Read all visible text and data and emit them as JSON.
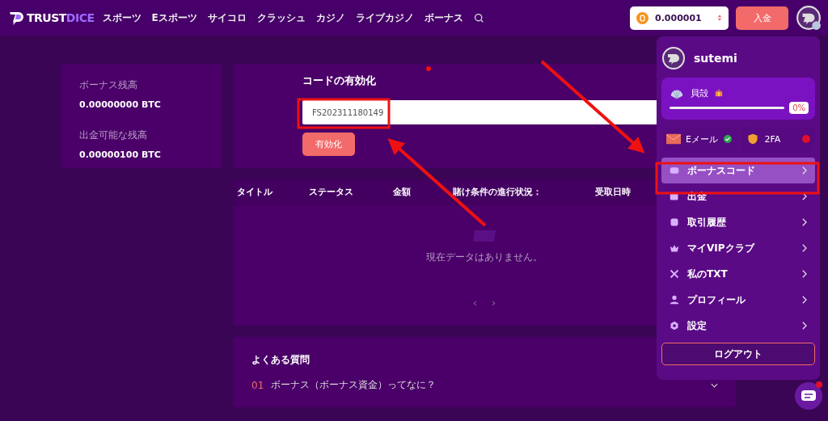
{
  "header": {
    "logo": {
      "part_1": "TRUST",
      "part_2": "DICE"
    },
    "nav": [
      {
        "label": "スポーツ"
      },
      {
        "label": "Eスポーツ"
      },
      {
        "label": "サイコロ"
      },
      {
        "label": "クラッシュ"
      },
      {
        "label": "カジノ"
      },
      {
        "label": "ライブカジノ"
      },
      {
        "label": "ボーナス"
      }
    ],
    "balance": "0.000001",
    "deposit_button": "入金"
  },
  "balances": [
    {
      "label": "ボーナス残高",
      "value": "0.00000000 BTC"
    },
    {
      "label": "出金可能な残高",
      "value": "0.00000100 BTC"
    }
  ],
  "code_activation": {
    "title": "コードの有効化",
    "value": "FS202311180149",
    "button": "有効化"
  },
  "table": {
    "columns": [
      "タイトル",
      "ステータス",
      "金額",
      "賭け条件の進行状況：",
      "受取日時"
    ],
    "empty_text": "現在データはありません。",
    "pager": [
      "‹",
      "›"
    ]
  },
  "faq": {
    "title": "よくある質問",
    "items": [
      {
        "number": "01",
        "question": "ボーナス（ボーナス資金）ってなに？"
      }
    ]
  },
  "user_menu": {
    "username": "sutemi",
    "vip": {
      "rank": "貝殻",
      "level": 0,
      "reading": "0%"
    },
    "security": [
      {
        "label": "Eメール",
        "verified": true
      },
      {
        "label": "2FA",
        "verified": false
      }
    ],
    "items": [
      {
        "label": "ボーナスコード",
        "selected": true
      },
      {
        "label": "出金",
        "selected": false
      },
      {
        "label": "取引履歴",
        "selected": false
      },
      {
        "label": "マイVIPクラブ",
        "selected": false
      },
      {
        "label": "私のTXT",
        "selected": false
      },
      {
        "label": "プロフィール",
        "selected": false
      },
      {
        "label": "設定",
        "selected": false
      }
    ],
    "logout": "ログアウト"
  }
}
